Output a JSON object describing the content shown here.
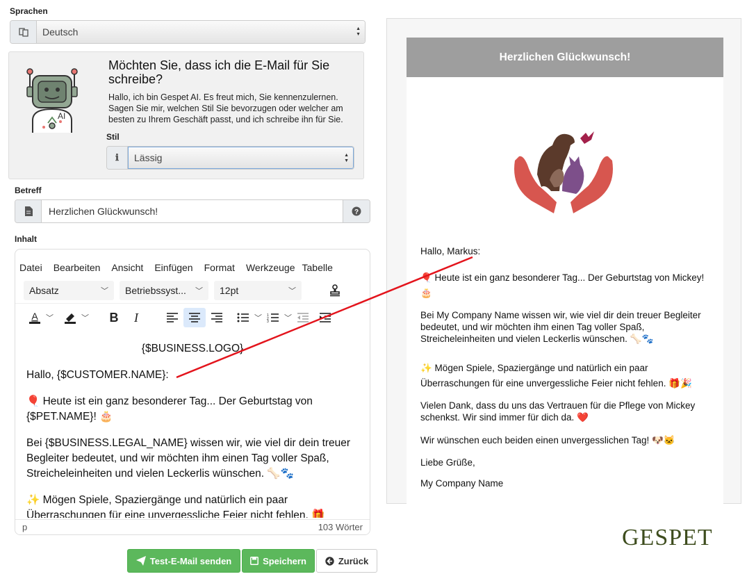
{
  "language": {
    "label": "Sprachen",
    "selected": "Deutsch"
  },
  "ai": {
    "title": "Möchten Sie, dass ich die E-Mail für Sie schreibe?",
    "description": "Hallo, ich bin Gespet AI. Es freut mich, Sie kennenzulernen. Sagen Sie mir, welchen Stil Sie bevorzugen oder welcher am besten zu Ihrem Geschäft passt, und ich schreibe ihn für Sie.",
    "style_label": "Stil",
    "style_selected": "Lässig",
    "robot_badge": "AI"
  },
  "subject": {
    "label": "Betreff",
    "value": "Herzlichen Glückwunsch!"
  },
  "content": {
    "label": "Inhalt",
    "menu": [
      "Datei",
      "Bearbeiten",
      "Ansicht",
      "Einfügen",
      "Format",
      "Werkzeuge",
      "Tabelle"
    ],
    "block_format": "Absatz",
    "font_family": "Betriebssyst...",
    "font_size": "12pt",
    "body": [
      "{$BUSINESS.LOGO}",
      "Hallo, {$CUSTOMER.NAME}:",
      "🎈 Heute ist ein ganz besonderer Tag... Der Geburtstag von {$PET.NAME}! 🎂",
      "Bei {$BUSINESS.LEGAL_NAME} wissen wir, wie viel dir dein treuer Begleiter bedeutet, und wir möchten ihm einen Tag voller Spaß, Streicheleinheiten und vielen Leckerlis wünschen. 🦴🐾",
      "✨ Mögen Spiele, Spaziergänge und natürlich ein paar Überraschungen für eine unvergessliche Feier nicht fehlen. 🎁"
    ],
    "status_path": "p",
    "word_count": "103 Wörter"
  },
  "buttons": {
    "test_email": "Test-E-Mail senden",
    "save": "Speichern",
    "back": "Zurück"
  },
  "preview": {
    "header": "Herzlichen Glückwunsch!",
    "greeting": "Hallo, Markus:",
    "p1": "🎈 Heute ist ein ganz besonderer Tag... Der Geburtstag von Mickey! 🎂",
    "p2": "Bei My Company Name wissen wir, wie viel dir dein treuer Begleiter bedeutet, und wir möchten ihm einen Tag voller Spaß, Streicheleinheiten und vielen Leckerlis wünschen. 🦴🐾",
    "p3": "✨ Mögen Spiele, Spaziergänge und natürlich ein paar Überraschungen für eine unvergessliche Feier nicht fehlen. 🎁🎉",
    "p4": "Vielen Dank, dass du uns das Vertrauen für die Pflege von Mickey schenkst. Wir sind immer für dich da. ❤️",
    "p5": "Wir wünschen euch beiden einen unvergesslichen Tag! 🐶🐱",
    "closing": "Liebe Grüße,",
    "signature": "My Company Name"
  },
  "brand": {
    "logo_text": "GESPET"
  },
  "colors": {
    "green": "#5cb85c",
    "preview_header": "#9e9e9e",
    "arrow": "#e3141c",
    "active_tool": "#dbe9fb"
  }
}
